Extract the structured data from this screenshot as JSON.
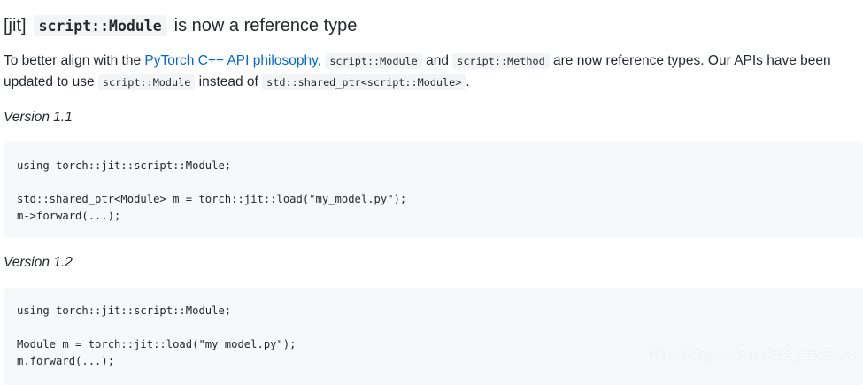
{
  "heading": {
    "tag": "[jit]",
    "code": "script::Module",
    "suffix": "is now a reference type"
  },
  "paragraph": {
    "t1": "To better align with the",
    "link": "PyTorch C++ API philosophy,",
    "c1": "script::Module",
    "t2": "and",
    "c2": "script::Method",
    "t3": "are now reference types. Our APIs have been",
    "t4": "updated to use",
    "c3": "script::Module",
    "t5": "instead of",
    "c4": "std::shared_ptr<script::Module>",
    "t6": "."
  },
  "versions": [
    {
      "label": "Version 1.1",
      "code_lines": [
        "using torch::jit::script::Module;",
        "",
        "std::shared_ptr<Module> m = torch::jit::load(\"my_model.py\");",
        "m->forward(...);"
      ]
    },
    {
      "label": "Version 1.2",
      "code_lines": [
        "using torch::jit::script::Module;",
        "",
        "Module m = torch::jit::load(\"my_model.py\");",
        "m.forward(...);"
      ]
    }
  ],
  "watermark": "https://blog.csdn.net/zzz_zzz12138",
  "colors": {
    "text": "#24292e",
    "link": "#0366d6",
    "code_background": "#f6f8fa",
    "inline_code_background": "#f3f4f5"
  }
}
